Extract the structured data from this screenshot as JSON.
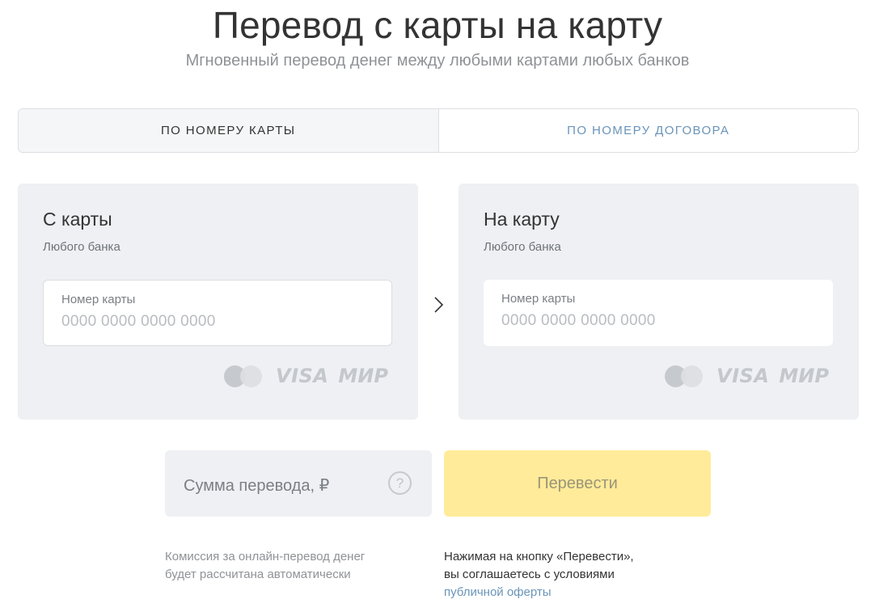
{
  "header": {
    "title": "Перевод с карты на карту",
    "subtitle": "Мгновенный перевод денег между любыми картами любых банков"
  },
  "tabs": [
    {
      "label": "ПО НОМЕРУ КАРТЫ",
      "active": true
    },
    {
      "label": "ПО НОМЕРУ ДОГОВОРА",
      "active": false
    }
  ],
  "from_card": {
    "title": "С карты",
    "subtitle": "Любого банка",
    "field_label": "Номер карты",
    "placeholder": "0000 0000 0000 0000"
  },
  "to_card": {
    "title": "На карту",
    "subtitle": "Любого банка",
    "field_label": "Номер карты",
    "placeholder": "0000 0000 0000 0000"
  },
  "payment_systems": {
    "visa": "VISA",
    "mir": "МИР"
  },
  "amount": {
    "placeholder": "Сумма перевода, ₽",
    "help": "?"
  },
  "submit": {
    "label": "Перевести"
  },
  "notes": {
    "commission_line1": "Комиссия за онлайн-перевод денег",
    "commission_line2": "будет рассчитана автоматически",
    "agreement_line1": "Нажимая на кнопку «Перевести»,",
    "agreement_line2": "вы соглашаетесь с условиями",
    "offer_link": "публичной оферты"
  },
  "colors": {
    "accent_yellow": "#ffeb99",
    "panel_bg": "#eef0f3",
    "link_blue": "#6a94b8"
  }
}
